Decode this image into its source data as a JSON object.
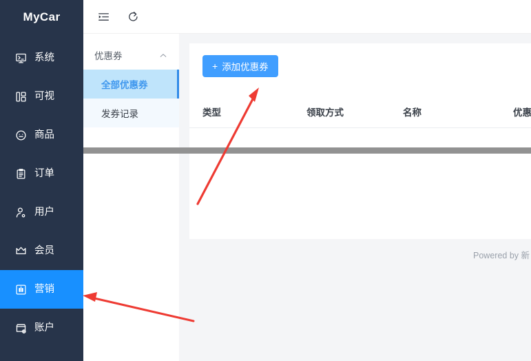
{
  "brand": {
    "title": "MyCar"
  },
  "sidebar": {
    "items": [
      {
        "label": "系统",
        "icon": "monitor-console-icon",
        "active": false
      },
      {
        "label": "可视",
        "icon": "dashboard-blocks-icon",
        "active": false
      },
      {
        "label": "商品",
        "icon": "goods-smile-icon",
        "active": false
      },
      {
        "label": "订单",
        "icon": "clipboard-order-icon",
        "active": false
      },
      {
        "label": "用户",
        "icon": "user-icon",
        "active": false
      },
      {
        "label": "会员",
        "icon": "crown-icon",
        "active": false
      },
      {
        "label": "营销",
        "icon": "gift-marketing-icon",
        "active": true
      },
      {
        "label": "账户",
        "icon": "shop-plus-icon",
        "active": false
      }
    ]
  },
  "topbar": {
    "menu_fold_icon": "menu-fold-icon",
    "refresh_icon": "refresh-icon"
  },
  "submenu": {
    "group_title": "优惠券",
    "collapse_icon": "chevron-up-icon",
    "items": [
      {
        "label": "全部优惠券",
        "selected": true
      },
      {
        "label": "发券记录",
        "selected": false
      }
    ]
  },
  "content": {
    "add_button": {
      "plus": "+",
      "label": "添加优惠券"
    },
    "table": {
      "columns": [
        "类型",
        "领取方式",
        "名称",
        "优惠"
      ],
      "rows": []
    },
    "scrollbar": {
      "orientation": "horizontal"
    }
  },
  "footer": {
    "text": "Powered by 新"
  },
  "colors": {
    "sidebar_bg": "#27344a",
    "accent": "#1890ff",
    "button_blue": "#409eff",
    "submenu_selected_bg": "#bfe4fb",
    "submenu_selected_text": "#4098ee",
    "content_bg": "#f4f5f7",
    "annotation_red": "#ee3b33",
    "scrollbar_thumb": "#929292"
  }
}
